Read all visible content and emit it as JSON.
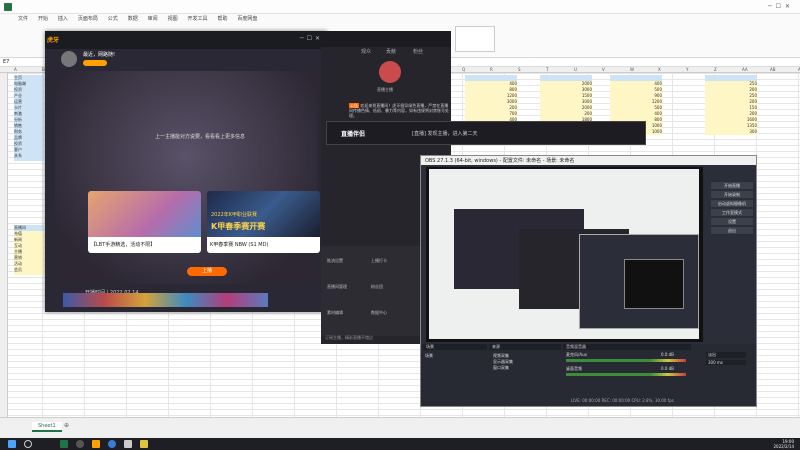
{
  "excel": {
    "menu_tabs": [
      "文件",
      "开始",
      "插入",
      "页面布局",
      "公式",
      "数据",
      "审阅",
      "视图",
      "开发工具",
      "帮助",
      "百度网盘"
    ],
    "cell_ref": "E7",
    "sheet_tab": "Sheet1",
    "col_headers": [
      "A",
      "B",
      "C",
      "D",
      "E",
      "F",
      "G",
      "H",
      "I",
      "J",
      "K",
      "L",
      "M",
      "N",
      "O",
      "P",
      "Q",
      "R",
      "S",
      "T",
      "U",
      "V",
      "W",
      "X",
      "Y",
      "Z",
      "AA",
      "AB",
      "AC"
    ],
    "left_list": [
      "主页",
      "电脑端",
      "投资",
      "产业",
      "运营",
      "卡片",
      "刺激",
      "分析",
      "销售",
      "财务",
      "品牌",
      "投资",
      "客户",
      "关系"
    ],
    "lower_list": [
      "直播间",
      "充值",
      "新闻",
      "互动",
      "主播",
      "营销",
      "活动",
      "会员"
    ],
    "col1": [
      "400",
      "800",
      "1200",
      "3000",
      "200",
      "700",
      "400",
      "800",
      "400"
    ],
    "col2": [
      "2000",
      "3000",
      "1500",
      "3000",
      "2000",
      "200",
      "1800",
      "1000"
    ],
    "col3": [
      "400",
      "500",
      "900",
      "1200",
      "500",
      "400",
      "800",
      "1000",
      "1000"
    ],
    "col4": [
      "3000",
      "200",
      "600",
      "900",
      "200",
      "1500"
    ],
    "col5": [
      "250",
      "200",
      "250",
      "200",
      "150",
      "200",
      "1600",
      "1350",
      "300"
    ]
  },
  "live": {
    "channel": "虎牙",
    "streamer": "最近，网路随!",
    "banner_text": "上一主播能对方说要，看看看上更多信息",
    "card1_title": "【LBT手游精选，活动不限】",
    "card1_meta": "4444",
    "card2_title": "K甲春季赛开赛",
    "card2_meta": "K甲春季赛 NBW (S1 MD)",
    "card2_overlay": "2022年K甲职业联赛",
    "sponsor": "开播时间",
    "date": "2022.02.14",
    "bottom_button": "上播"
  },
  "side": {
    "tabs": [
      "观众",
      "贡献",
      "粉丝"
    ],
    "follow": "关注",
    "avatar_label": "直播主播",
    "notice": "欢迎来到直播间！虎牙倡导绿色直播，严禁在直播间传播色情、低俗、暴力等内容，如有违规将封禁账号处理。",
    "icons": [
      "推流设置",
      "直播间管理",
      "素材编辑",
      "上播打卡",
      "粉丝团",
      "数据中心",
      "直播回放",
      "商城",
      "其他"
    ],
    "footer": "订阅主播，精彩直播不错过"
  },
  "mini": {
    "logo": "直播伴侣",
    "title": "[直播] 发现主播，进入第二天",
    "tab": "直播"
  },
  "obs": {
    "title": "OBS 27.1.3 (64-bit, windows) - 配置文件: 未命名 - 场景: 未命名",
    "right_buttons": [
      "开始直播",
      "开始录制",
      "启动虚拟摄像机",
      "工作室模式",
      "设置",
      "退出"
    ],
    "scene_header": "场景",
    "source_header": "来源",
    "mixer_header": "音频混音器",
    "scene_item": "场景",
    "source_items": [
      "视频采集",
      "显示器采集",
      "窗口采集"
    ],
    "mixer_items": [
      "麦克风/Aux",
      "桌面音频"
    ],
    "mixer_db": [
      "0.0 dB",
      "0.0 dB"
    ],
    "transition": "淡出",
    "duration": "300 ms",
    "status": "LIVE: 00:00:00   REC: 00:00:00   CPU: 2.8%, 30.00 fps"
  },
  "taskbar": {
    "time": "19:00",
    "date": "2022/2/14"
  },
  "colors": {
    "excel_green": "#217346",
    "accent_orange": "#ff6a00",
    "obs_dark": "#2b2e38",
    "taskbar": "#1e1f24"
  }
}
